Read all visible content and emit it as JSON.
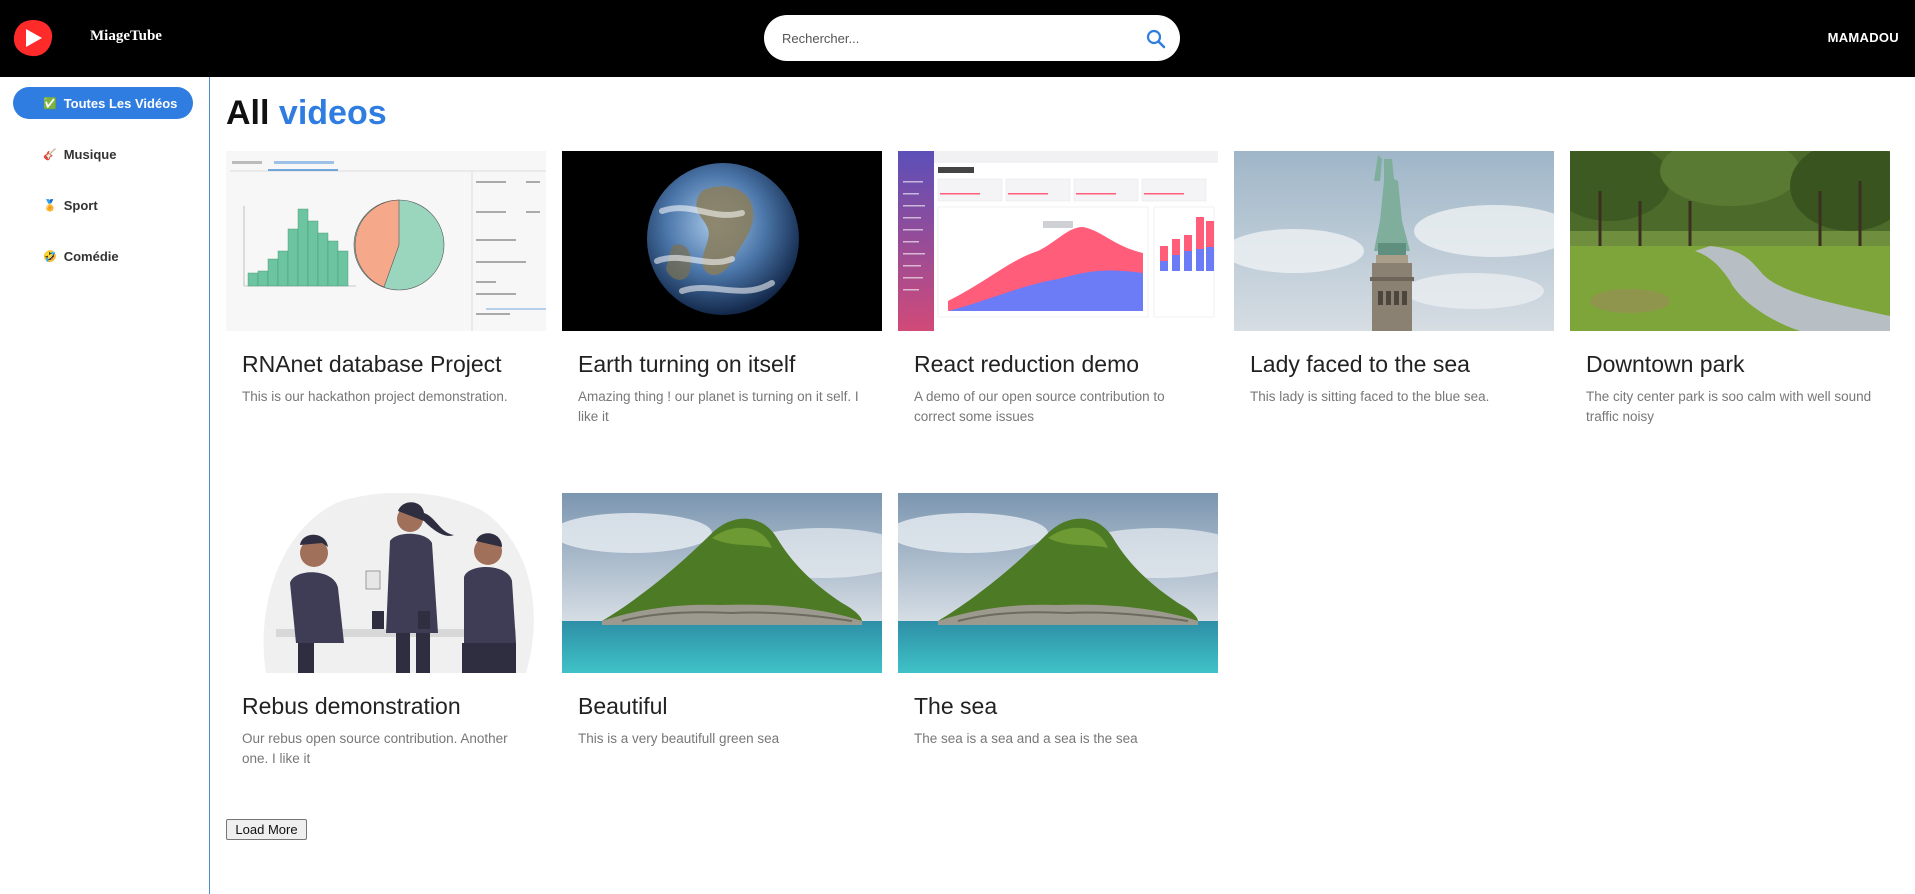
{
  "header": {
    "brand": "MiageTube",
    "search_placeholder": "Rechercher...",
    "user_name": "MAMADOU",
    "brand_color": "#ff2a2a"
  },
  "sidebar": {
    "items": [
      {
        "icon": "✅",
        "label": "Toutes Les Vidéos",
        "active": true
      },
      {
        "icon": "🎸",
        "label": "Musique",
        "active": false
      },
      {
        "icon": "🏅",
        "label": "Sport",
        "active": false
      },
      {
        "icon": "🤣",
        "label": "Comédie",
        "active": false
      }
    ],
    "active_color": "#2f7de1"
  },
  "main": {
    "title_plain": "All",
    "title_accent": "videos",
    "videos": [
      {
        "title": "RNAnet database Project",
        "description": "This is our hackathon project demonstration.",
        "thumbnail": "chart-dashboard"
      },
      {
        "title": "Earth turning on itself",
        "description": "Amazing thing ! our planet is turning on it self. I like it",
        "thumbnail": "earth"
      },
      {
        "title": "React reduction demo",
        "description": "A demo of our open source contribution to correct some issues",
        "thumbnail": "react-dashboard"
      },
      {
        "title": "Lady faced to the sea",
        "description": "This lady is sitting faced to the blue sea.",
        "thumbnail": "statue"
      },
      {
        "title": "Downtown park",
        "description": "The city center park is soo calm with well sound traffic noisy",
        "thumbnail": "park"
      },
      {
        "title": "Rebus demonstration",
        "description": "Our rebus open source contribution. Another one. I like it",
        "thumbnail": "people-illustration"
      },
      {
        "title": "Beautiful",
        "description": "This is a very beautifull green sea",
        "thumbnail": "island"
      },
      {
        "title": "The sea",
        "description": "The sea is a sea and a sea is the sea",
        "thumbnail": "island"
      }
    ],
    "load_more_label": "Load More"
  }
}
